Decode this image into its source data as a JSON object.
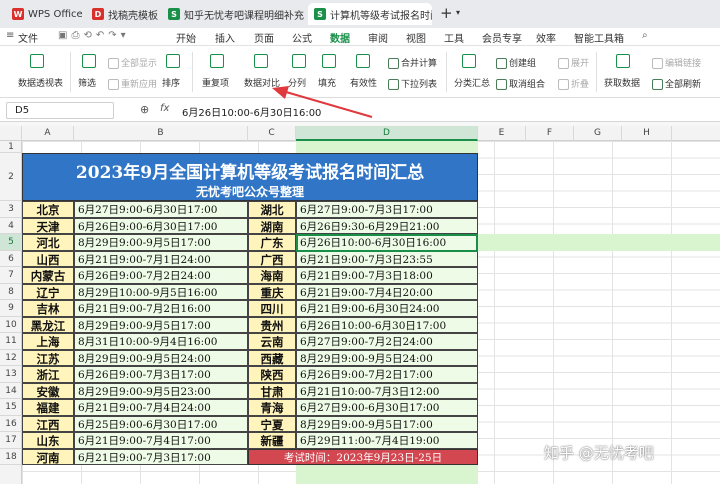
{
  "tabs": [
    {
      "label": "WPS Office",
      "icon": "wps-icon",
      "color": "#d9302c"
    },
    {
      "label": "找稿壳模板",
      "icon": "docer-icon",
      "color": "#d9302c"
    },
    {
      "label": "知乎无忧考吧课程明细补充",
      "icon": "sheet-icon",
      "color": "#1a8f4a"
    },
    {
      "label": "计算机等级考试报名时间表",
      "icon": "sheet-icon",
      "color": "#1a8f4a"
    }
  ],
  "menu": {
    "file": "文件",
    "items": [
      "开始",
      "插入",
      "页面",
      "公式",
      "数据",
      "审阅",
      "视图",
      "工具",
      "会员专享",
      "效率",
      "智能工具箱"
    ],
    "active": "数据"
  },
  "ribbon": {
    "pivot": "数据透视表",
    "filter": "筛选",
    "all_show": "全部显示",
    "reapply": "重新应用",
    "sort": "排序",
    "dup": "重复项",
    "compare": "数据对比",
    "split": "分列",
    "fill": "填充",
    "validity": "有效性",
    "dropdown": "下拉列表",
    "merge_calc": "合并计算",
    "subtotal": "分类汇总",
    "create_group": "创建组",
    "ungroup": "取消组合",
    "expand": "展开",
    "collapse": "折叠",
    "get_data": "获取数据",
    "refresh_all": "全部刷新",
    "edit_link": "编辑链接"
  },
  "formula": {
    "cell": "D5",
    "fx": "fx",
    "value": "6月26日10:00-6月30日16:00"
  },
  "columns": [
    "A",
    "B",
    "C",
    "D",
    "E",
    "F",
    "G",
    "H"
  ],
  "selected_column": "D",
  "selected_row": "5",
  "title_main": "2023年9月全国计算机等级考试报名时间汇总",
  "title_sub": "无忧考吧公众号整理",
  "left": [
    {
      "p": "北京",
      "t": "6月27日9:00-6月30日17:00"
    },
    {
      "p": "天津",
      "t": "6月26日9:00-6月30日17:00"
    },
    {
      "p": "河北",
      "t": "8月29日9:00-9月5日17:00"
    },
    {
      "p": "山西",
      "t": "6月21日9:00-7月1日24:00"
    },
    {
      "p": "内蒙古",
      "t": "6月26日9:00-7月2日24:00"
    },
    {
      "p": "辽宁",
      "t": "8月29日10:00-9月5日16:00"
    },
    {
      "p": "吉林",
      "t": "6月21日9:00-7月2日16:00"
    },
    {
      "p": "黑龙江",
      "t": "8月29日9:00-9月5日17:00"
    },
    {
      "p": "上海",
      "t": "8月31日10:00-9月4日16:00"
    },
    {
      "p": "江苏",
      "t": "8月29日9:00-9月5日24:00"
    },
    {
      "p": "浙江",
      "t": "6月26日9:00-7月3日17:00"
    },
    {
      "p": "安徽",
      "t": "8月29日9:00-9月5日23:00"
    },
    {
      "p": "福建",
      "t": "6月21日9:00-7月4日24:00"
    },
    {
      "p": "江西",
      "t": "6月25日9:00-6月30日17:00"
    },
    {
      "p": "山东",
      "t": "6月21日9:00-7月4日17:00"
    },
    {
      "p": "河南",
      "t": "6月21日9:00-7月3日17:00"
    }
  ],
  "right": [
    {
      "p": "湖北",
      "t": "6月27日9:00-7月3日17:00"
    },
    {
      "p": "湖南",
      "t": "6月26日9:30-6月29日21:00"
    },
    {
      "p": "广东",
      "t": "6月26日10:00-6月30日16:00"
    },
    {
      "p": "广西",
      "t": "6月21日9:00-7月3日23:55"
    },
    {
      "p": "海南",
      "t": "6月21日9:00-7月3日18:00"
    },
    {
      "p": "重庆",
      "t": "6月21日9:00-7月4日20:00"
    },
    {
      "p": "四川",
      "t": "6月21日9:00-6月30日24:00"
    },
    {
      "p": "贵州",
      "t": "6月26日10:00-6月30日17:00"
    },
    {
      "p": "云南",
      "t": "6月27日9:00-7月2日24:00"
    },
    {
      "p": "西藏",
      "t": "8月29日9:00-9月5日24:00"
    },
    {
      "p": "陕西",
      "t": "6月26日9:00-7月2日17:00"
    },
    {
      "p": "甘肃",
      "t": "6月21日10:00-7月3日12:00"
    },
    {
      "p": "青海",
      "t": "6月27日9:00-6月30日17:00"
    },
    {
      "p": "宁夏",
      "t": "8月29日9:00-9月5日17:00"
    },
    {
      "p": "新疆",
      "t": "6月29日11:00-7月4日19:00"
    }
  ],
  "exam_note": "考试时间：2023年9月23日-25日",
  "watermark": "知乎 @无忧考吧"
}
